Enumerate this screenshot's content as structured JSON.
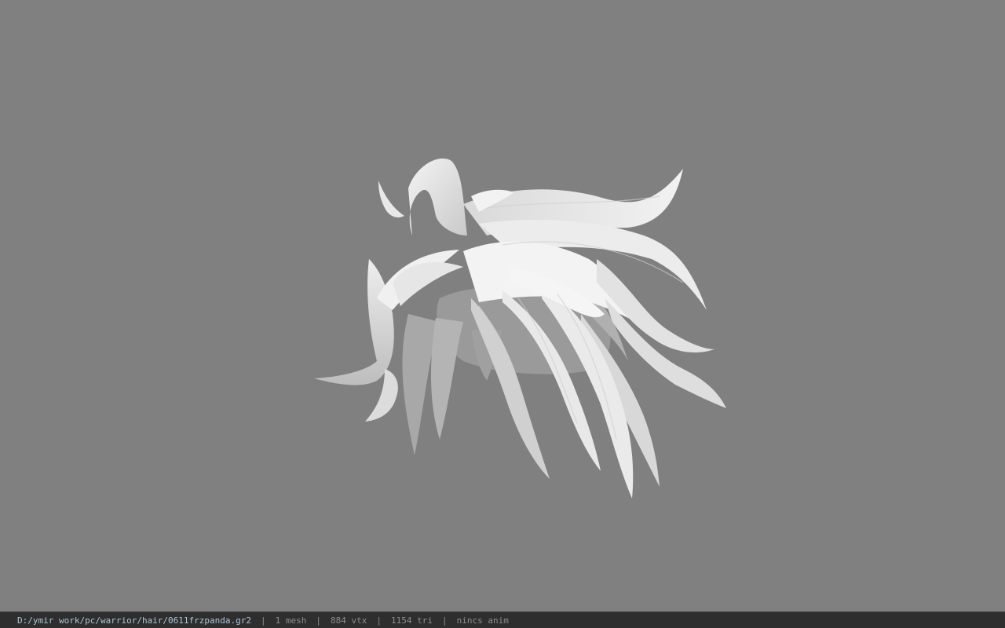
{
  "viewport": {
    "model": "hair-mesh",
    "background_color": "#808080",
    "mesh_color": "#e4e4e4"
  },
  "status_bar": {
    "file_path": "D:/ymir work/pc/warrior/hair/0611frzpanda.gr2",
    "separator": "|",
    "mesh_count": "1 mesh",
    "vertex_count": "884 vtx",
    "triangle_count": "1154 tri",
    "anim": "nincs anim"
  }
}
